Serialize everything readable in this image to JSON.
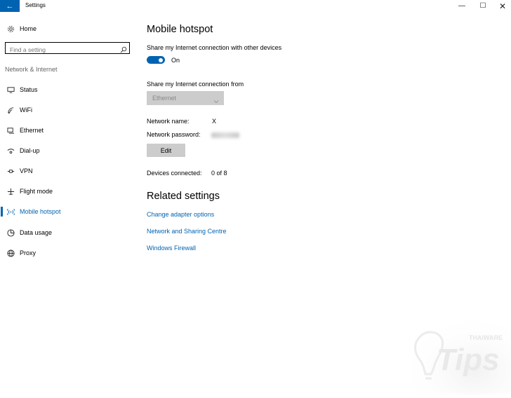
{
  "window": {
    "title": "Settings",
    "back_icon": "←",
    "minimize_icon": "—",
    "maximize_icon": "☐",
    "close_icon": "✕"
  },
  "sidebar": {
    "home": {
      "label": "Home",
      "icon": "gear-icon"
    },
    "search": {
      "placeholder": "Find a setting",
      "value": ""
    },
    "section_label": "Network & Internet",
    "items": [
      {
        "label": "Status",
        "icon": "status-icon",
        "active": false
      },
      {
        "label": "WiFi",
        "icon": "wifi-icon",
        "active": false
      },
      {
        "label": "Ethernet",
        "icon": "ethernet-icon",
        "active": false
      },
      {
        "label": "Dial-up",
        "icon": "dialup-icon",
        "active": false
      },
      {
        "label": "VPN",
        "icon": "vpn-icon",
        "active": false
      },
      {
        "label": "Flight mode",
        "icon": "airplane-icon",
        "active": false
      },
      {
        "label": "Mobile hotspot",
        "icon": "hotspot-icon",
        "active": true
      },
      {
        "label": "Data usage",
        "icon": "data-usage-icon",
        "active": false
      },
      {
        "label": "Proxy",
        "icon": "globe-icon",
        "active": false
      }
    ]
  },
  "main": {
    "title": "Mobile hotspot",
    "share_label": "Share my Internet connection with other devices",
    "toggle_state": "On",
    "share_from_label": "Share my Internet connection from",
    "share_from_value": "Ethernet",
    "network_name_label": "Network name:",
    "network_name_value": "X",
    "network_password_label": "Network password:",
    "edit_label": "Edit",
    "devices_connected_label": "Devices connected:",
    "devices_connected_value": "0 of 8",
    "related_title": "Related settings",
    "links": [
      "Change adapter options",
      "Network and Sharing Centre",
      "Windows Firewall"
    ]
  },
  "watermark": {
    "text_small": "THAIWARE",
    "text_large": "Tips"
  },
  "colors": {
    "accent": "#0063b1",
    "control_gray": "#cccccc"
  }
}
